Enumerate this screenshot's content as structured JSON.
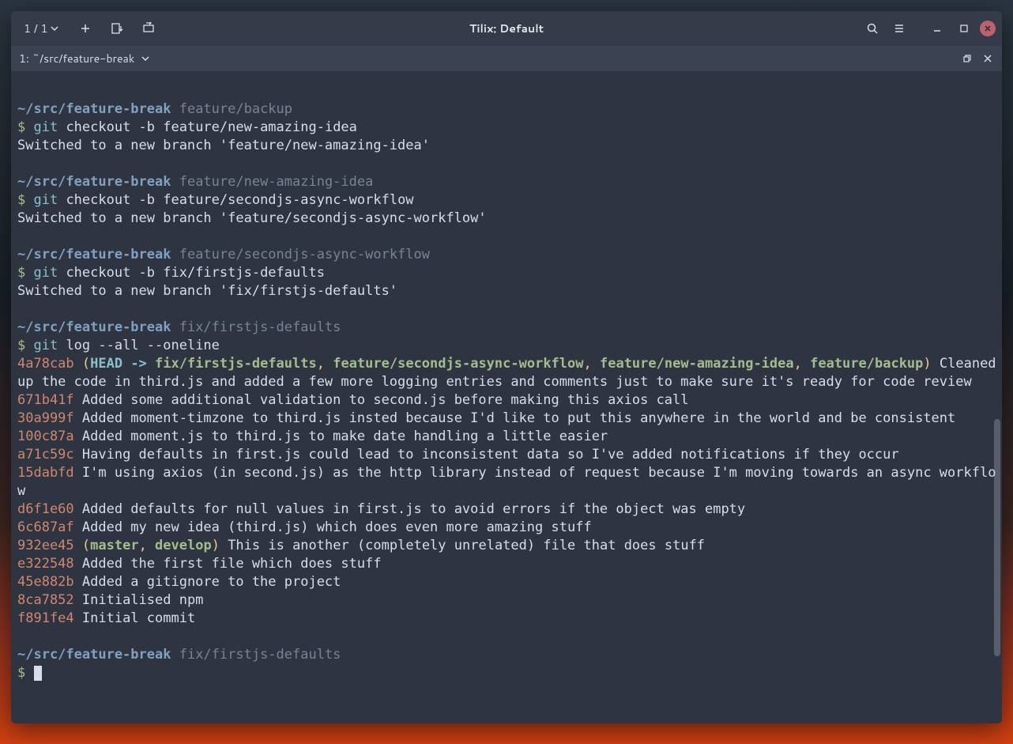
{
  "titlebar": {
    "counter": "1 / 1",
    "title": "Tilix: Default"
  },
  "tabbar": {
    "label": "1: ~/src/feature-break"
  },
  "colors": {
    "path": "#81a1c1",
    "branch": "#788494",
    "prompt": "#a3be8c",
    "cmd": "#88c0d0",
    "hash": "#d08770",
    "head": "#88c0d0",
    "refgreen": "#a3be8c",
    "yellow": "#ebcb8b",
    "fg": "#d8dee9",
    "bg": "#2e3440"
  },
  "prompts": [
    {
      "path": "~/src/feature-break",
      "branch": "feature/backup",
      "cmd_prefix": "git",
      "cmd_rest": " checkout -b feature/new-amazing-idea",
      "output": "Switched to a new branch 'feature/new-amazing-idea'"
    },
    {
      "path": "~/src/feature-break",
      "branch": "feature/new-amazing-idea",
      "cmd_prefix": "git",
      "cmd_rest": " checkout -b feature/secondjs-async-workflow",
      "output": "Switched to a new branch 'feature/secondjs-async-workflow'"
    },
    {
      "path": "~/src/feature-break",
      "branch": "feature/secondjs-async-workflow",
      "cmd_prefix": "git",
      "cmd_rest": " checkout -b fix/firstjs-defaults",
      "output": "Switched to a new branch 'fix/firstjs-defaults'"
    },
    {
      "path": "~/src/feature-break",
      "branch": "fix/firstjs-defaults",
      "cmd_prefix": "git",
      "cmd_rest": " log --all --oneline",
      "output": ""
    }
  ],
  "log": {
    "head_hash": "4a78cab",
    "head_label": "HEAD -> ",
    "head_ref": "fix/firstjs-defaults",
    "head_other_refs": [
      "feature/secondjs-async-workflow",
      "feature/new-amazing-idea",
      "feature/backup"
    ],
    "head_msg": " Cleaned up the code in third.js and added a few more logging entries and comments just to make sure it's ready for code review",
    "entries": [
      {
        "hash": "671b41f",
        "msg": "Added some additional validation to second.js before making this axios call"
      },
      {
        "hash": "30a999f",
        "msg": "Added moment-timzone to third.js insted because I'd like to put this anywhere in the world and be consistent"
      },
      {
        "hash": "100c87a",
        "msg": "Added moment.js to third.js to make date handling a little easier"
      },
      {
        "hash": "a71c59c",
        "msg": "Having defaults in first.js could lead to inconsistent data so I've added notifications if they occur"
      },
      {
        "hash": "15dabfd",
        "msg": "I'm using axios (in second.js) as the http library instead of request because I'm moving towards an async workflow"
      },
      {
        "hash": "d6f1e60",
        "msg": "Added defaults for null values in first.js to avoid errors if the object was empty"
      },
      {
        "hash": "6c687af",
        "msg": "Added my new idea (third.js) which does even more amazing stuff"
      }
    ],
    "master_hash": "932ee45",
    "master_refs": [
      "master",
      "develop"
    ],
    "master_msg": "This is another (completely unrelated) file that does stuff",
    "tail": [
      {
        "hash": "e322548",
        "msg": "Added the first file which does stuff"
      },
      {
        "hash": "45e882b",
        "msg": "Added a gitignore to the project"
      },
      {
        "hash": "8ca7852",
        "msg": "Initialised npm"
      },
      {
        "hash": "f891fe4",
        "msg": "Initial commit"
      }
    ]
  },
  "final_prompt": {
    "path": "~/src/feature-break",
    "branch": "fix/firstjs-defaults"
  },
  "sep": ", ",
  "paren_open": " (",
  "paren_close": ") ",
  "paren_close_nb": ")",
  "dollar": "$ "
}
